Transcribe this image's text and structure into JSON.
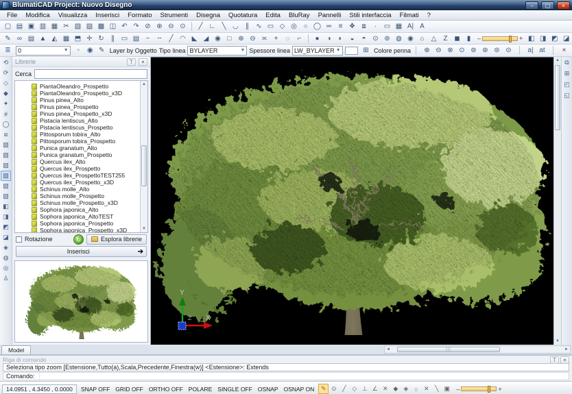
{
  "window": {
    "title": "BlumatiCAD Project: Nuovo Disegno",
    "minimize": "–",
    "maximize": "▢",
    "close": "×"
  },
  "menu": {
    "items": [
      {
        "n": "menu-file",
        "g": "File"
      },
      {
        "n": "menu-modifica",
        "g": "Modifica"
      },
      {
        "n": "menu-visualizza",
        "g": "Visualizza"
      },
      {
        "n": "menu-inserisci",
        "g": "Inserisci"
      },
      {
        "n": "menu-formato",
        "g": "Formato"
      },
      {
        "n": "menu-strumenti",
        "g": "Strumenti"
      },
      {
        "n": "menu-disegna",
        "g": "Disegna"
      },
      {
        "n": "menu-quotatura",
        "g": "Quotatura"
      },
      {
        "n": "menu-edita",
        "g": "Edita"
      },
      {
        "n": "menu-bluray",
        "g": "BluRay"
      },
      {
        "n": "menu-pannelli",
        "g": "Pannelli"
      },
      {
        "n": "menu-stili-interfaccia",
        "g": "Stili interfaccia"
      },
      {
        "n": "menu-filmati",
        "g": "Filmati"
      },
      {
        "n": "menu-help",
        "g": "?"
      }
    ]
  },
  "toolbar1": {
    "file_icons": [
      {
        "n": "new-icon",
        "g": "▢"
      },
      {
        "n": "open-icon",
        "g": "▤"
      },
      {
        "n": "save-icon",
        "g": "▣"
      },
      {
        "n": "save-as-icon",
        "g": "▥"
      },
      {
        "n": "print-icon",
        "g": "▦"
      },
      {
        "n": "cut-icon",
        "g": "✂"
      },
      {
        "n": "copy-icon",
        "g": "▧"
      },
      {
        "n": "paste-icon",
        "g": "▨"
      },
      {
        "n": "insert-image-icon",
        "g": "▩"
      },
      {
        "n": "paste-block-icon",
        "g": "◫"
      },
      {
        "n": "undo-icon",
        "g": "↶"
      },
      {
        "n": "redo-icon",
        "g": "↷"
      },
      {
        "n": "pan-icon",
        "g": "⊘"
      },
      {
        "n": "zoom-window-icon",
        "g": "⊕"
      },
      {
        "n": "zoom-in-icon",
        "g": "⊖"
      },
      {
        "n": "zoom-out-icon",
        "g": "⊙"
      }
    ],
    "draw_icons": [
      {
        "n": "line-icon",
        "g": "╱"
      },
      {
        "n": "polyline-icon",
        "g": "∟"
      },
      {
        "n": "construction-line-icon",
        "g": "╲"
      },
      {
        "n": "arc-icon",
        "g": "◡"
      },
      {
        "n": "parallel-icon",
        "g": "∥"
      },
      {
        "n": "spline-icon",
        "g": "∿"
      },
      {
        "n": "rectangle-icon",
        "g": "▭"
      },
      {
        "n": "polygon-icon",
        "g": "◇"
      },
      {
        "n": "donut-icon",
        "g": "◎"
      },
      {
        "n": "circle-icon",
        "g": "○"
      },
      {
        "n": "ellipse-icon",
        "g": "◯"
      },
      {
        "n": "equal-lines-icon",
        "g": "═"
      },
      {
        "n": "multiline-icon",
        "g": "≡"
      },
      {
        "n": "block-icon",
        "g": "❖"
      },
      {
        "n": "group-icon",
        "g": "⧈"
      },
      {
        "n": "point-icon",
        "g": "·"
      },
      {
        "n": "clip-rect-icon",
        "g": "▭"
      },
      {
        "n": "clip-image-icon",
        "g": "▦"
      },
      {
        "n": "text-style-icon",
        "g": "A|"
      },
      {
        "n": "text-icon",
        "g": "A"
      }
    ]
  },
  "toolbar2": {
    "modify_icons": [
      {
        "n": "sketch-icon",
        "g": "✎"
      },
      {
        "n": "link-icon",
        "g": "∞"
      },
      {
        "n": "image-adjust-icon",
        "g": "▤"
      },
      {
        "n": "extrude-icon",
        "g": "▲"
      },
      {
        "n": "slope-icon",
        "g": "◭"
      },
      {
        "n": "wall-icon",
        "g": "▦"
      },
      {
        "n": "3d-rotate-icon",
        "g": "⬒"
      },
      {
        "n": "move-icon",
        "g": "✛"
      },
      {
        "n": "rotate-icon",
        "g": "↻"
      },
      {
        "n": "offset-icon",
        "g": "∥"
      },
      {
        "n": "rename-icon",
        "g": "▭"
      },
      {
        "n": "frame-icon",
        "g": "▤"
      },
      {
        "n": "trim-icon",
        "g": "−"
      },
      {
        "n": "extend-icon",
        "g": "╌"
      },
      {
        "n": "break-icon",
        "g": "╱"
      },
      {
        "n": "fillet-icon",
        "g": "◠"
      },
      {
        "n": "chamfer-icon",
        "g": "◣"
      },
      {
        "n": "bevel-icon",
        "g": "◢"
      },
      {
        "n": "region-icon",
        "g": "◉"
      },
      {
        "n": "box-select-icon",
        "g": "□"
      },
      {
        "n": "zoom-plus-icon",
        "g": "⊕"
      },
      {
        "n": "zoom-minus-icon",
        "g": "⊖"
      },
      {
        "n": "measure-icon",
        "g": "≍"
      },
      {
        "n": "cross-icon",
        "g": "+"
      },
      {
        "n": "mark-icon",
        "g": "◌"
      },
      {
        "n": "corner-icon",
        "g": "⌐"
      }
    ],
    "view_icons": [
      {
        "n": "sphere-icon",
        "g": "●"
      },
      {
        "n": "half-shade-icon",
        "g": "◑"
      },
      {
        "n": "material-icon",
        "g": "◐"
      },
      {
        "n": "texture-icon",
        "g": "◒"
      },
      {
        "n": "light-icon",
        "g": "◓"
      },
      {
        "n": "sun-icon",
        "g": "⊙"
      },
      {
        "n": "camera-icon",
        "g": "⊚"
      },
      {
        "n": "target-icon",
        "g": "◍"
      },
      {
        "n": "render-icon",
        "g": "◉"
      },
      {
        "n": "house-icon",
        "g": "⌂"
      },
      {
        "n": "prism-icon",
        "g": "△"
      },
      {
        "n": "z-axis-icon",
        "g": "Z"
      },
      {
        "n": "solid-icon",
        "g": "◼"
      },
      {
        "n": "column-icon",
        "g": "▮"
      }
    ],
    "render_icons": [
      {
        "n": "paint-icon",
        "g": "◧"
      },
      {
        "n": "blue-hand-icon",
        "g": "◨"
      },
      {
        "n": "layout-plan-icon",
        "g": "◩"
      },
      {
        "n": "building-icon",
        "g": "◪"
      },
      {
        "n": "shade-icon",
        "g": "◬"
      },
      {
        "n": "wire-icon",
        "g": "◭"
      },
      {
        "n": "box-3d-icon",
        "g": "▦"
      }
    ]
  },
  "layerbar": {
    "layers_icon": "≣",
    "layer_value": "0",
    "tool_icons": [
      {
        "n": "freeze-layer-icon",
        "g": "◦"
      },
      {
        "n": "layer-state-icon",
        "g": "◉"
      },
      {
        "n": "pencil-yellow-icon",
        "g": "✎"
      }
    ],
    "layer_by_label": "Layer by Oggetto",
    "tipo_linea_label": "Tipo linea",
    "tipo_linea_value": "BYLAYER",
    "spessore_label": "Spessore linea",
    "spessore_value": "LW_BYLAYER",
    "colore_icon": "⊞",
    "colore_label": "Colore penna",
    "zoom_icons": [
      {
        "n": "zoom-extents-icon",
        "g": "⊕"
      },
      {
        "n": "zoom-window-icon",
        "g": "⊖"
      },
      {
        "n": "zoom-dynamic-icon",
        "g": "⊗"
      },
      {
        "n": "zoom-scale-icon",
        "g": "⊙"
      },
      {
        "n": "zoom-center-icon",
        "g": "⊚"
      },
      {
        "n": "zoom-object-icon",
        "g": "⊛"
      },
      {
        "n": "zoom-previous-icon",
        "g": "⊜"
      },
      {
        "n": "zoom-all-icon",
        "g": "⊝"
      }
    ],
    "text_icons": [
      {
        "n": "text-cursor-icon",
        "g": "a|"
      },
      {
        "n": "text-edit-icon",
        "g": "at"
      }
    ],
    "close_icon": "×"
  },
  "leftstrip": {
    "icons": [
      {
        "n": "orbit-icon",
        "g": "⟲"
      },
      {
        "n": "free-orbit-icon",
        "g": "⟳"
      },
      {
        "n": "diamond-tool-icon",
        "g": "◇"
      },
      {
        "n": "gem-tool-icon",
        "g": "◆"
      },
      {
        "n": "star-tool-icon",
        "g": "✦"
      },
      {
        "n": "mesh-tool-icon",
        "g": "#"
      },
      {
        "n": "circle-tool-icon",
        "g": "◯"
      },
      {
        "n": "shapes-tool-icon",
        "g": "⧈"
      },
      {
        "n": "box-iso-1-icon",
        "g": "▧"
      },
      {
        "n": "box-iso-2-icon",
        "g": "▧"
      },
      {
        "n": "box-iso-3-icon",
        "g": "▧"
      },
      {
        "n": "box-iso-4-icon",
        "g": "▧",
        "hl": true
      },
      {
        "n": "box-iso-5-icon",
        "g": "▧"
      },
      {
        "n": "box-iso-6-icon",
        "g": "▧"
      },
      {
        "n": "shade-flat-icon",
        "g": "◧"
      },
      {
        "n": "shade-gouraud-icon",
        "g": "◨"
      },
      {
        "n": "shade-hidden-icon",
        "g": "◩"
      },
      {
        "n": "shade-wire-icon",
        "g": "◪"
      },
      {
        "n": "eraser-tool-icon",
        "g": "◈"
      },
      {
        "n": "material-tool-icon",
        "g": "◍"
      },
      {
        "n": "texture-tool-icon",
        "g": "◎"
      },
      {
        "n": "walk-tool-icon",
        "g": "♙"
      }
    ]
  },
  "rightstrip": {
    "icons": [
      {
        "n": "cascade-windows-icon",
        "g": "⧉"
      },
      {
        "n": "tile-windows-icon",
        "g": "⊞"
      },
      {
        "n": "layout-manager-icon",
        "g": "◰"
      },
      {
        "n": "viewport-config-icon",
        "g": "◱"
      }
    ]
  },
  "library": {
    "title": "Librerie",
    "pin_icon": "⊤",
    "close_icon": "×",
    "search_label": "Cerca",
    "items": [
      "PiantaOleandro_Prospetto",
      "PiantaOleandro_Prospetto_x3D",
      "Pinus pinea_Alto",
      "Pinus pinea_Prospetto",
      "Pinus pinea_Prospetto_x3D",
      "Pistacia lentiscus_Alto",
      "Pistacia lentiscus_Prospetto",
      "Pittosporum tobira_Alto",
      "Pittosporum tobira_Prospetto",
      "Punica granatum_Alto",
      "Punica granatum_Prospetto",
      "Quercus ilex_Alto",
      "Quercus ilex_Prospetto",
      "Quercus ilex_ProspettoTEST255",
      "Quercus ilex_Prospetto_x3D",
      "Schinus molle_Alto",
      "Schinus molle_Prospetto",
      "Schinus molle_Prospetto_x3D",
      "Sophora japonica_Alto",
      "Sophora japonica_AltoTEST",
      "Sophora japonica_Prospetto",
      "Sophora japonica_Prospetto_x3D"
    ],
    "rotazione_label": "Rotazione",
    "esplora_label": "Esplora librerie",
    "inserisci_label": "Inserisci",
    "inserisci_arrow": "➔"
  },
  "viewport": {
    "model_tab": "Model",
    "axis_x": "X",
    "axis_y": "Y",
    "axis_z": "Z"
  },
  "command": {
    "header": "Riga di comando",
    "pin_icon": "⊤",
    "close_icon": "×",
    "history": "Seleziona tipo zoom [Estensione,Tutto(a),Scala,Precedente,Finestra(w)] <Estensione>: Extends",
    "prompt_label": "Comando:"
  },
  "status": {
    "coords": "14.0951 , 4.3450 , 0.0000",
    "toggles": [
      {
        "n": "snap-toggle",
        "g": "SNAP OFF"
      },
      {
        "n": "grid-toggle",
        "g": "GRID OFF"
      },
      {
        "n": "ortho-toggle",
        "g": "ORTHO OFF"
      },
      {
        "n": "polare-toggle",
        "g": "POLARE"
      },
      {
        "n": "single-toggle",
        "g": "SINGLE OFF"
      },
      {
        "n": "osnap-toggle",
        "g": "OSNAP"
      },
      {
        "n": "osnap-on-toggle",
        "g": "OSNAP ON"
      }
    ],
    "osnap_icons": [
      {
        "n": "draw-order-icon",
        "g": "✎",
        "hl": true
      },
      {
        "n": "center-snap-icon",
        "g": "⊙"
      },
      {
        "n": "endpoint-snap-icon",
        "g": "╱"
      },
      {
        "n": "polygon-snap-icon",
        "g": "◇"
      },
      {
        "n": "perpendicular-snap-icon",
        "g": "⊥"
      },
      {
        "n": "angle-snap-icon",
        "g": "∠"
      },
      {
        "n": "intersection-snap-icon",
        "g": "✕"
      },
      {
        "n": "point-snap-icon",
        "g": "◆"
      },
      {
        "n": "quadrant-snap-icon",
        "g": "◈"
      },
      {
        "n": "circle-snap-icon",
        "g": "○"
      },
      {
        "n": "near-snap-icon",
        "g": "✕"
      },
      {
        "n": "tangent-snap-icon",
        "g": "╲"
      },
      {
        "n": "insert-snap-icon",
        "g": "▣"
      }
    ],
    "slider_minus": "–",
    "slider_plus": "+"
  }
}
